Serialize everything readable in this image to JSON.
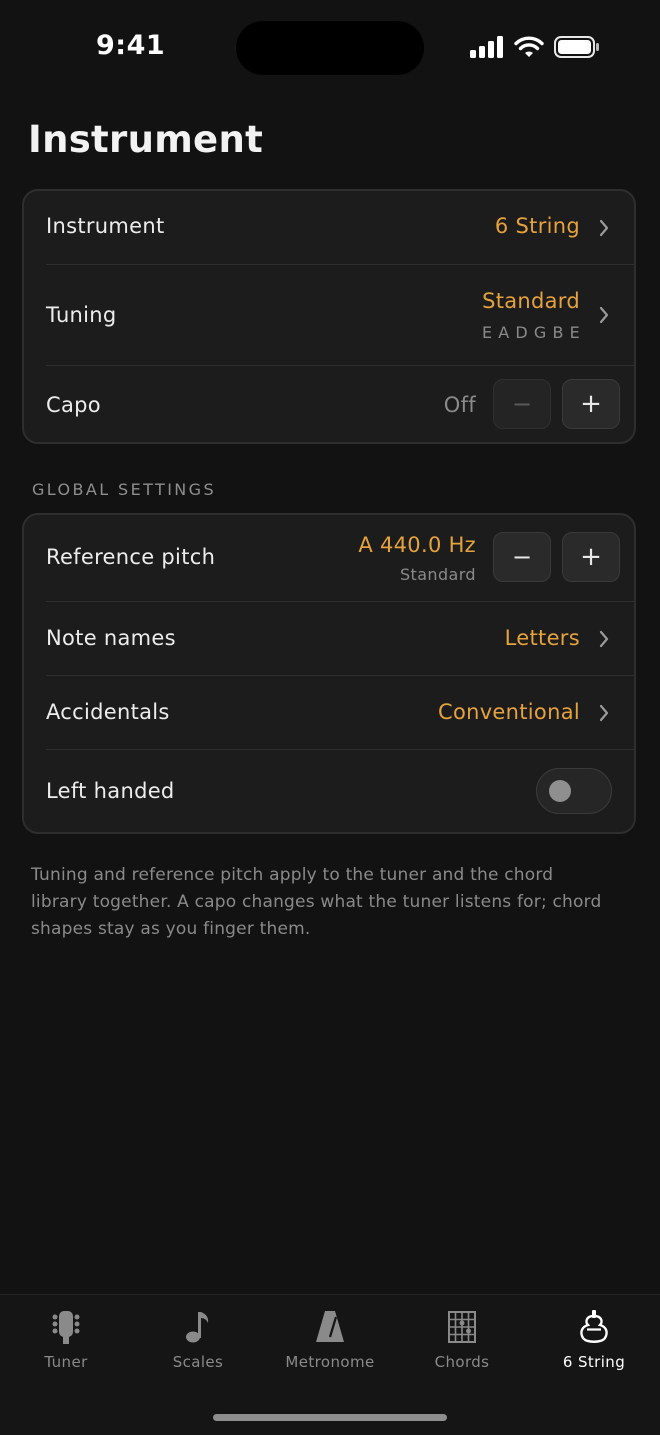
{
  "status_bar": {
    "time": "9:41"
  },
  "page_title": "Instrument",
  "instrument_card": {
    "instrument": {
      "label": "Instrument",
      "value": "6 String"
    },
    "tuning": {
      "label": "Tuning",
      "value": "Standard",
      "notes": "EADGBE"
    },
    "capo": {
      "label": "Capo",
      "value": "Off",
      "minus": "−",
      "plus": "+"
    }
  },
  "global_settings": {
    "header": "GLOBAL SETTINGS",
    "reference_pitch": {
      "label": "Reference pitch",
      "value": "A 440.0 Hz",
      "subvalue": "Standard",
      "minus": "−",
      "plus": "+"
    },
    "note_names": {
      "label": "Note names",
      "value": "Letters"
    },
    "accidentals": {
      "label": "Accidentals",
      "value": "Conventional"
    },
    "left_handed": {
      "label": "Left handed",
      "enabled": false
    }
  },
  "footnote": "Tuning and reference pitch apply to the tuner and the chord library together. A capo changes what the tuner listens for; chord shapes stay as you finger them.",
  "tabs": [
    {
      "label": "Tuner",
      "icon": "guitar-headstock-icon",
      "active": false
    },
    {
      "label": "Scales",
      "icon": "music-note-icon",
      "active": false
    },
    {
      "label": "Metronome",
      "icon": "metronome-icon",
      "active": false
    },
    {
      "label": "Chords",
      "icon": "chord-grid-icon",
      "active": false
    },
    {
      "label": "6 String",
      "icon": "guitar-body-icon",
      "active": true
    }
  ],
  "colors": {
    "accent": "#E6A23C",
    "background": "#121212",
    "card": "#1C1C1C"
  }
}
